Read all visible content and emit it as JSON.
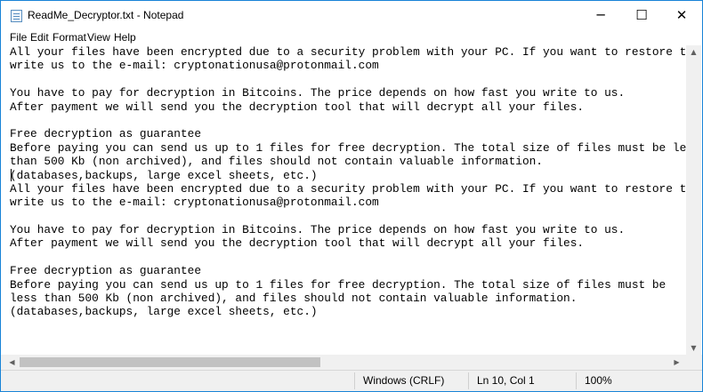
{
  "window": {
    "title": "ReadMe_Decryptor.txt - Notepad"
  },
  "controls": {
    "minimize": "─",
    "maximize": "☐",
    "close": "✕"
  },
  "menu": [
    "File",
    "Edit",
    "Format",
    "View",
    "Help"
  ],
  "editor": {
    "lines": [
      "All your files have been encrypted due to a security problem with your PC. If you want to restore them,",
      "write us to the e-mail: cryptonationusa@protonmail.com",
      "",
      "You have to pay for decryption in Bitcoins. The price depends on how fast you write to us.",
      "After payment we will send you the decryption tool that will decrypt all your files.",
      "",
      "Free decryption as guarantee",
      "Before paying you can send us up to 1 files for free decryption. The total size of files must be less",
      "than 500 Kb (non archived), and files should not contain valuable information.",
      "(databases,backups, large excel sheets, etc.)",
      "All your files have been encrypted due to a security problem with your PC. If you want to restore them,",
      "write us to the e-mail: cryptonationusa@protonmail.com",
      "",
      "You have to pay for decryption in Bitcoins. The price depends on how fast you write to us.",
      "After payment we will send you the decryption tool that will decrypt all your files.",
      "",
      "Free decryption as guarantee",
      "Before paying you can send us up to 1 files for free decryption. The total size of files must be",
      "less than 500 Kb (non archived), and files should not contain valuable information.",
      "(databases,backups, large excel sheets, etc.)"
    ]
  },
  "scrollbars": {
    "up": "▲",
    "down": "▼",
    "left": "◀",
    "right": "▶"
  },
  "status": {
    "encoding": "Windows (CRLF)",
    "position": "Ln 10, Col 1",
    "zoom": "100%"
  }
}
